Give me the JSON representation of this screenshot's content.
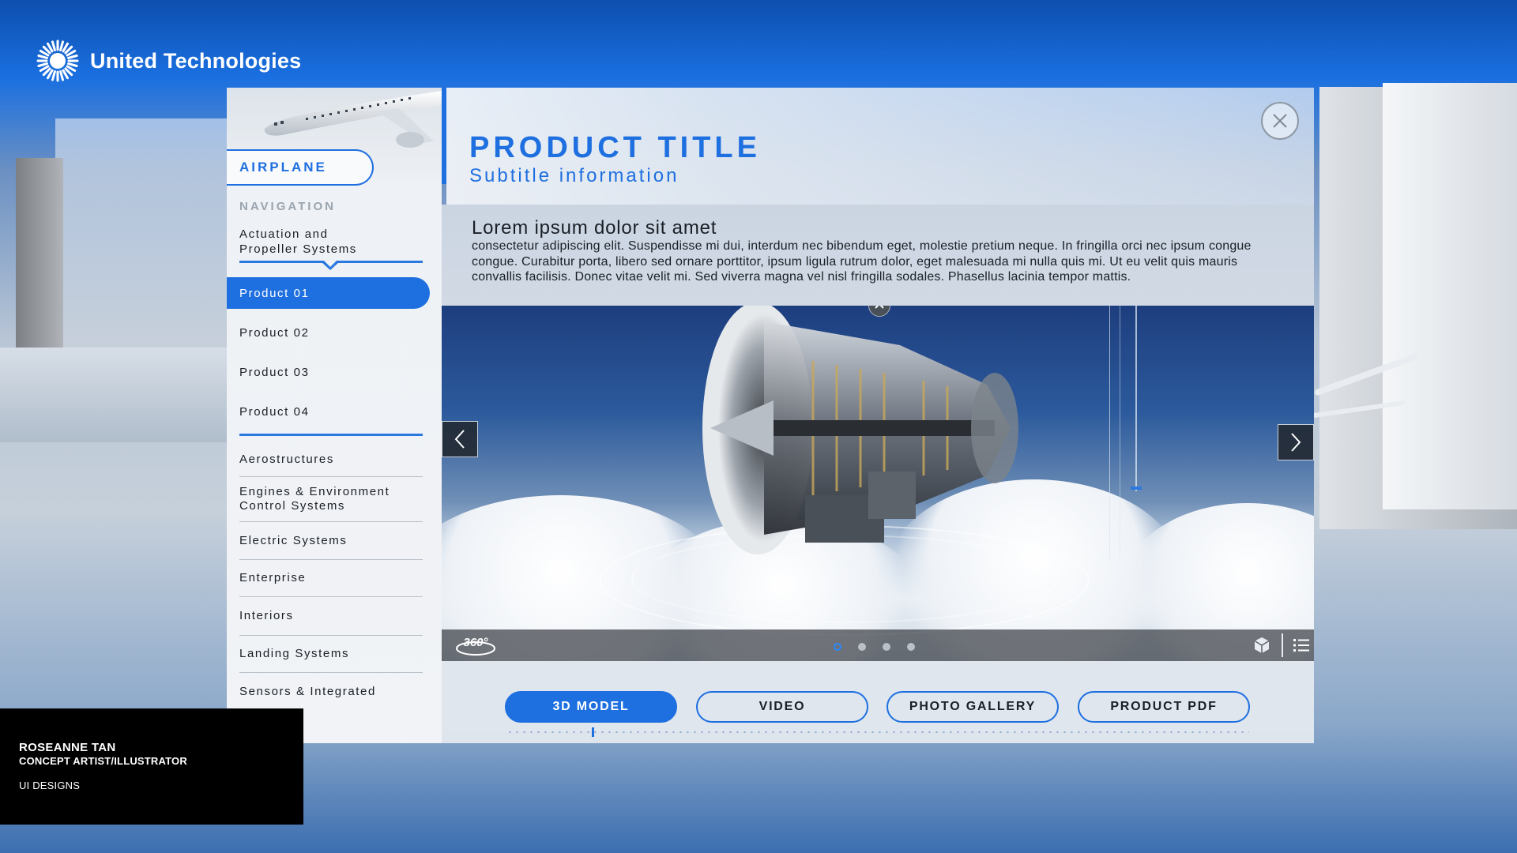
{
  "brand": {
    "name": "United Technologies"
  },
  "sidebar": {
    "active_section": "AIRPLANE",
    "nav_heading": "NAVIGATION",
    "parent_category": "Actuation and\nPropeller Systems",
    "products": [
      {
        "label": "Product 01",
        "active": true
      },
      {
        "label": "Product 02",
        "active": false
      },
      {
        "label": "Product 03",
        "active": false
      },
      {
        "label": "Product 04",
        "active": false
      }
    ],
    "categories": [
      {
        "label": "Aerostructures"
      },
      {
        "label": "Engines & Environment\nControl Systems"
      },
      {
        "label": "Electric Systems"
      },
      {
        "label": "Enterprise"
      },
      {
        "label": "Interiors"
      },
      {
        "label": "Landing Systems"
      },
      {
        "label": "Sensors & Integrated"
      }
    ]
  },
  "header": {
    "title": "PRODUCT TITLE",
    "subtitle": "Subtitle information"
  },
  "description": {
    "heading": "Lorem ipsum dolor sit amet",
    "body": "consectetur adipiscing elit. Suspendisse mi dui, interdum nec bibendum eget, molestie pretium neque. In fringilla orci nec ipsum congue congue. Curabitur porta, libero sed ornare porttitor, ipsum ligula rutrum dolor, eget malesuada mi nulla quis mi. Ut eu velit quis mauris convallis facilisis. Donec vitae velit mi. Sed viverra magna vel nisl fringilla sodales. Phasellus lacinia tempor mattis."
  },
  "viewer": {
    "rotate_label": "360°",
    "slide_count": 4,
    "active_slide": 1
  },
  "tabs": [
    {
      "label": "3D MODEL",
      "active": true
    },
    {
      "label": "VIDEO",
      "active": false
    },
    {
      "label": "PHOTO GALLERY",
      "active": false
    },
    {
      "label": "PRODUCT PDF",
      "active": false
    }
  ],
  "credit": {
    "name": "ROSEANNE TAN",
    "role": "CONCEPT ARTIST/ILLUSTRATOR",
    "section": "UI DESIGNS"
  },
  "colors": {
    "accent": "#1e6fe0",
    "header_blue": "#0d4fae"
  },
  "icons": [
    "sunburst-logo-icon",
    "close-icon",
    "chevron-up-icon",
    "chevron-left-icon",
    "chevron-right-icon",
    "rotate-360-icon",
    "cube-icon",
    "list-icon"
  ]
}
